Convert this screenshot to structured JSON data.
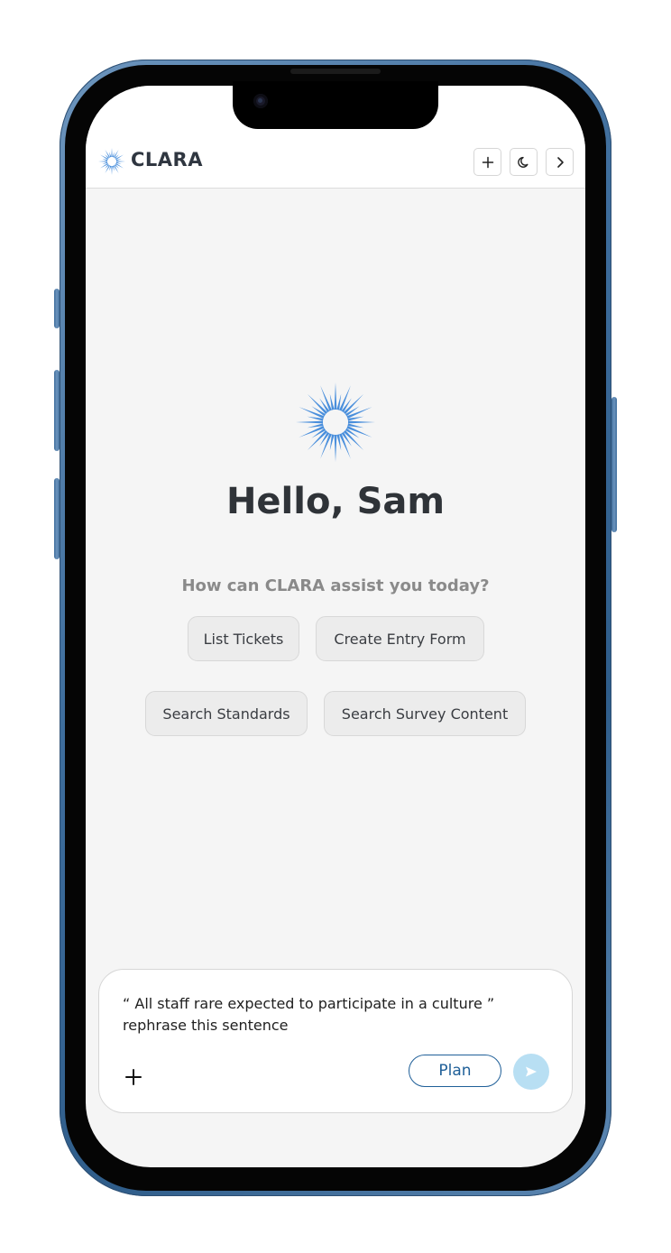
{
  "header": {
    "brand": "CLARA",
    "new_chat_icon": "plus-icon",
    "theme_icon": "moon-icon",
    "collapse_icon": "chevron-right-icon"
  },
  "hero": {
    "greeting": "Hello, Sam",
    "subtitle": "How can CLARA assist you today?"
  },
  "suggestions": [
    {
      "label": "List Tickets"
    },
    {
      "label": "Create Entry Form"
    },
    {
      "label": "Search Standards"
    },
    {
      "label": "Search Survey Content"
    }
  ],
  "composer": {
    "line1": "“ All staff rare expected to participate in a culture ”",
    "line2": "rephrase this sentence",
    "plan_label": "Plan",
    "attach_icon": "plus-icon",
    "send_icon": "send-icon"
  },
  "colors": {
    "accent_blue": "#4a8fdc",
    "plan_blue": "#1f5f98",
    "send_disabled": "#b8dff3"
  }
}
